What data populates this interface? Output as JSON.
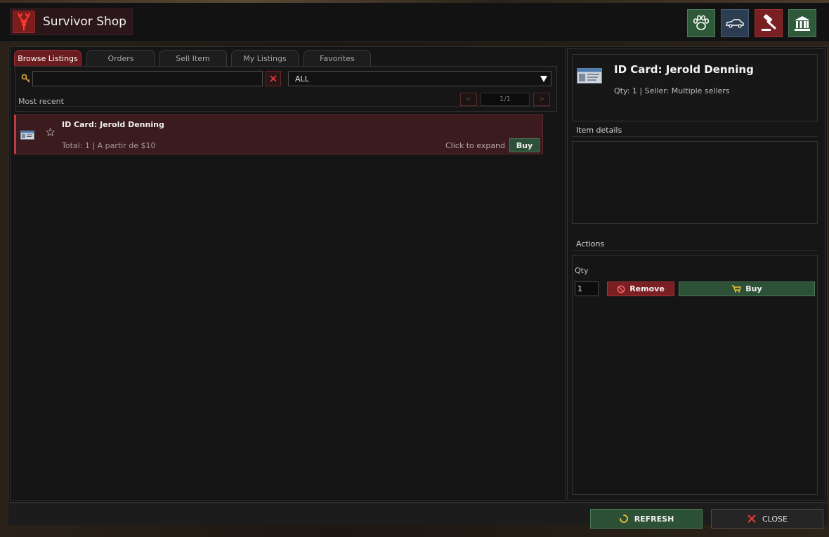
{
  "header": {
    "title": "Survivor Shop",
    "logo_icon": "deer-antler-icon",
    "icons": [
      {
        "name": "paw-icon",
        "color": "#2e5a3a"
      },
      {
        "name": "car-icon",
        "color": "#2c3d52"
      },
      {
        "name": "gavel-icon",
        "color": "#7a1f22"
      },
      {
        "name": "bank-icon",
        "color": "#2e5a3a"
      }
    ]
  },
  "tabs": [
    {
      "label": "Browse Listings",
      "active": true
    },
    {
      "label": "Orders",
      "active": false
    },
    {
      "label": "Sell Item",
      "active": false
    },
    {
      "label": "My Listings",
      "active": false
    },
    {
      "label": "Favorites",
      "active": false
    }
  ],
  "filters": {
    "search_value": "",
    "search_icon": "key-icon",
    "category": "ALL",
    "sort_label": "Most recent",
    "page_display": "1/1",
    "prev_label": "<",
    "next_label": ">"
  },
  "listings": [
    {
      "name": "ID Card: Jerold Denning",
      "meta": "Total: 1 | A partir de $10",
      "hint": "Click to expand",
      "buy_label": "Buy",
      "favorite": false
    }
  ],
  "detail": {
    "name": "ID Card: Jerold Denning",
    "meta": "Qty: 1 | Seller: Multiple sellers",
    "item_details_label": "Item details",
    "actions_label": "Actions",
    "qty_label": "Qty",
    "qty_value": "1",
    "remove_label": "Remove",
    "buy_label": "Buy"
  },
  "footer": {
    "refresh_label": "REFRESH",
    "close_label": "CLOSE"
  },
  "colors": {
    "accent_red": "#7a1f22",
    "accent_green": "#2d5136",
    "accent_blue": "#2c3d52"
  }
}
